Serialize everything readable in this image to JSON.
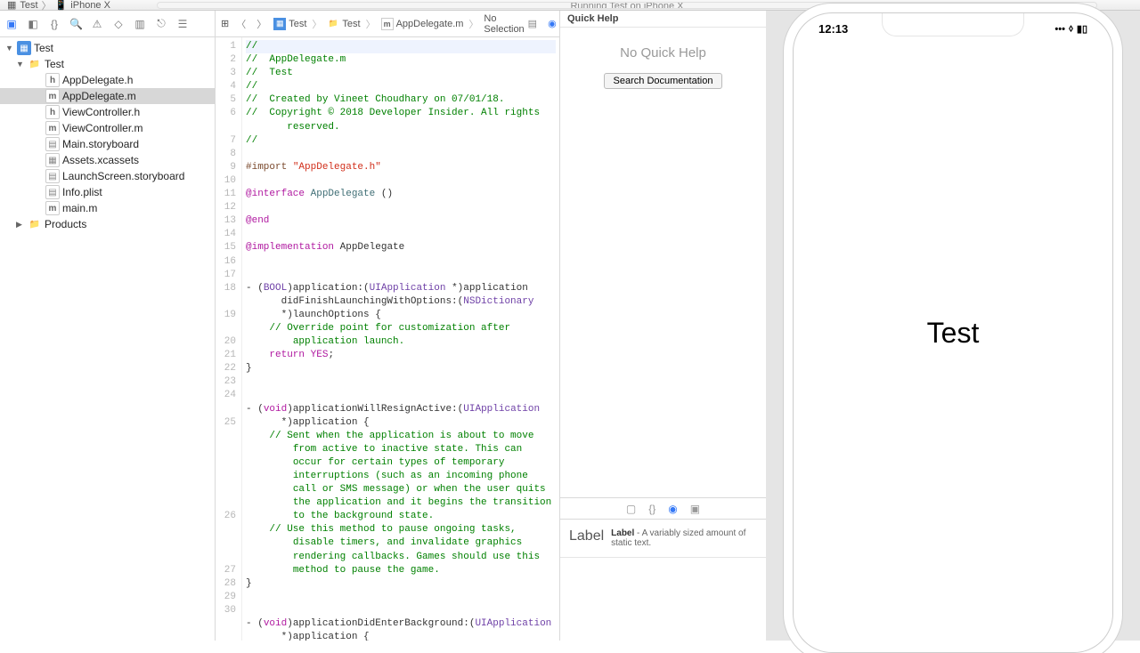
{
  "toolbar": {
    "scheme_app": "Test",
    "scheme_device": "iPhone X",
    "status": "Running Test on iPhone X"
  },
  "navigator": {
    "project": "Test",
    "group": "Test",
    "files": [
      {
        "name": "AppDelegate.h",
        "kind": "h"
      },
      {
        "name": "AppDelegate.m",
        "kind": "m",
        "selected": true
      },
      {
        "name": "ViewController.h",
        "kind": "h"
      },
      {
        "name": "ViewController.m",
        "kind": "m"
      },
      {
        "name": "Main.storyboard",
        "kind": "sb"
      },
      {
        "name": "Assets.xcassets",
        "kind": "assets"
      },
      {
        "name": "LaunchScreen.storyboard",
        "kind": "sb"
      },
      {
        "name": "Info.plist",
        "kind": "plist"
      },
      {
        "name": "main.m",
        "kind": "m"
      }
    ],
    "products": "Products"
  },
  "jumpbar": {
    "p1": "Test",
    "p2": "Test",
    "p3": "AppDelegate.m",
    "p4": "No Selection"
  },
  "code": {
    "lines": [
      {
        "n": 1,
        "cur": true,
        "seg": [
          {
            "c": "c-comment",
            "t": "//"
          }
        ]
      },
      {
        "n": 2,
        "seg": [
          {
            "c": "c-comment",
            "t": "//  AppDelegate.m"
          }
        ]
      },
      {
        "n": 3,
        "seg": [
          {
            "c": "c-comment",
            "t": "//  Test"
          }
        ]
      },
      {
        "n": 4,
        "seg": [
          {
            "c": "c-comment",
            "t": "//"
          }
        ]
      },
      {
        "n": 5,
        "seg": [
          {
            "c": "c-comment",
            "t": "//  Created by Vineet Choudhary on 07/01/18."
          }
        ]
      },
      {
        "n": 6,
        "seg": [
          {
            "c": "c-comment",
            "t": "//  Copyright © 2018 Developer Insider. All rights\n       reserved."
          }
        ]
      },
      {
        "n": 7,
        "seg": [
          {
            "c": "c-comment",
            "t": "//"
          }
        ]
      },
      {
        "n": 8,
        "seg": [
          {
            "c": "",
            "t": ""
          }
        ]
      },
      {
        "n": 9,
        "seg": [
          {
            "c": "c-import",
            "t": "#import "
          },
          {
            "c": "c-string",
            "t": "\"AppDelegate.h\""
          }
        ]
      },
      {
        "n": 10,
        "seg": [
          {
            "c": "",
            "t": ""
          }
        ]
      },
      {
        "n": 11,
        "seg": [
          {
            "c": "c-kw",
            "t": "@interface"
          },
          {
            "c": "",
            "t": " "
          },
          {
            "c": "c-class",
            "t": "AppDelegate"
          },
          {
            "c": "",
            "t": " ()"
          }
        ]
      },
      {
        "n": 12,
        "seg": [
          {
            "c": "",
            "t": ""
          }
        ]
      },
      {
        "n": 13,
        "seg": [
          {
            "c": "c-kw",
            "t": "@end"
          }
        ]
      },
      {
        "n": 14,
        "seg": [
          {
            "c": "",
            "t": ""
          }
        ]
      },
      {
        "n": 15,
        "seg": [
          {
            "c": "c-kw",
            "t": "@implementation"
          },
          {
            "c": "",
            "t": " AppDelegate"
          }
        ]
      },
      {
        "n": 16,
        "seg": [
          {
            "c": "",
            "t": ""
          }
        ]
      },
      {
        "n": 17,
        "seg": [
          {
            "c": "",
            "t": ""
          }
        ]
      },
      {
        "n": 18,
        "seg": [
          {
            "c": "",
            "t": "- ("
          },
          {
            "c": "c-type",
            "t": "BOOL"
          },
          {
            "c": "",
            "t": ")application:("
          },
          {
            "c": "c-type",
            "t": "UIApplication"
          },
          {
            "c": "",
            "t": " *)application\n      didFinishLaunchingWithOptions:("
          },
          {
            "c": "c-type",
            "t": "NSDictionary"
          },
          {
            "c": "",
            "t": "\n      *)launchOptions {"
          }
        ]
      },
      {
        "n": 19,
        "seg": [
          {
            "c": "c-comment",
            "t": "    // Override point for customization after\n        application launch."
          }
        ]
      },
      {
        "n": 20,
        "seg": [
          {
            "c": "",
            "t": "    "
          },
          {
            "c": "c-kw",
            "t": "return"
          },
          {
            "c": "",
            "t": " "
          },
          {
            "c": "c-kw",
            "t": "YES"
          },
          {
            "c": "",
            "t": ";"
          }
        ]
      },
      {
        "n": 21,
        "seg": [
          {
            "c": "",
            "t": "}"
          }
        ]
      },
      {
        "n": 22,
        "seg": [
          {
            "c": "",
            "t": ""
          }
        ]
      },
      {
        "n": 23,
        "seg": [
          {
            "c": "",
            "t": ""
          }
        ]
      },
      {
        "n": 24,
        "seg": [
          {
            "c": "",
            "t": "- ("
          },
          {
            "c": "c-kw",
            "t": "void"
          },
          {
            "c": "",
            "t": ")applicationWillResignActive:("
          },
          {
            "c": "c-type",
            "t": "UIApplication"
          },
          {
            "c": "",
            "t": "\n      *)application {"
          }
        ]
      },
      {
        "n": 25,
        "seg": [
          {
            "c": "c-comment",
            "t": "    // Sent when the application is about to move\n        from active to inactive state. This can\n        occur for certain types of temporary\n        interruptions (such as an incoming phone\n        call or SMS message) or when the user quits\n        the application and it begins the transition\n        to the background state."
          }
        ]
      },
      {
        "n": 26,
        "seg": [
          {
            "c": "c-comment",
            "t": "    // Use this method to pause ongoing tasks,\n        disable timers, and invalidate graphics\n        rendering callbacks. Games should use this\n        method to pause the game."
          }
        ]
      },
      {
        "n": 27,
        "seg": [
          {
            "c": "",
            "t": "}"
          }
        ]
      },
      {
        "n": 28,
        "seg": [
          {
            "c": "",
            "t": ""
          }
        ]
      },
      {
        "n": 29,
        "seg": [
          {
            "c": "",
            "t": ""
          }
        ]
      },
      {
        "n": 30,
        "seg": [
          {
            "c": "",
            "t": "- ("
          },
          {
            "c": "c-kw",
            "t": "void"
          },
          {
            "c": "",
            "t": ")applicationDidEnterBackground:("
          },
          {
            "c": "c-type",
            "t": "UIApplication"
          },
          {
            "c": "",
            "t": "\n      *)application {"
          }
        ]
      }
    ]
  },
  "inspector": {
    "quick_help_title": "Quick Help",
    "no_help": "No Quick Help",
    "search_doc": "Search Documentation",
    "lib_item_thumb": "Label",
    "lib_item_title": "Label",
    "lib_item_desc": " - A variably sized amount of static text."
  },
  "simulator": {
    "time": "12:13",
    "app_text": "Test"
  }
}
